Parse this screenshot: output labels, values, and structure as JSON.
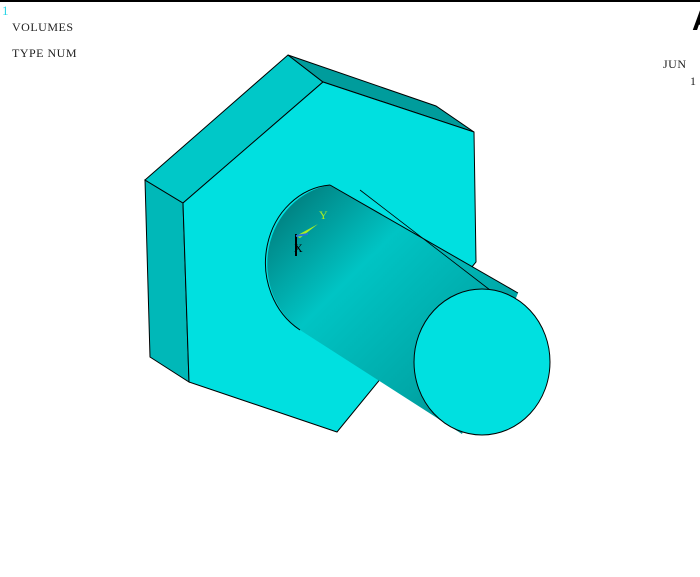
{
  "window_number": "1",
  "labels": {
    "line1": "VOLUMES",
    "line2": "TYPE NUM"
  },
  "logo": "A",
  "date": {
    "month": "JUN",
    "day": "1"
  },
  "triad": {
    "x": "X",
    "y": "Y"
  },
  "colors": {
    "face": "#00e0e0",
    "side": "#00b0b0",
    "dark": "#008f8f",
    "edge": "#000000"
  }
}
